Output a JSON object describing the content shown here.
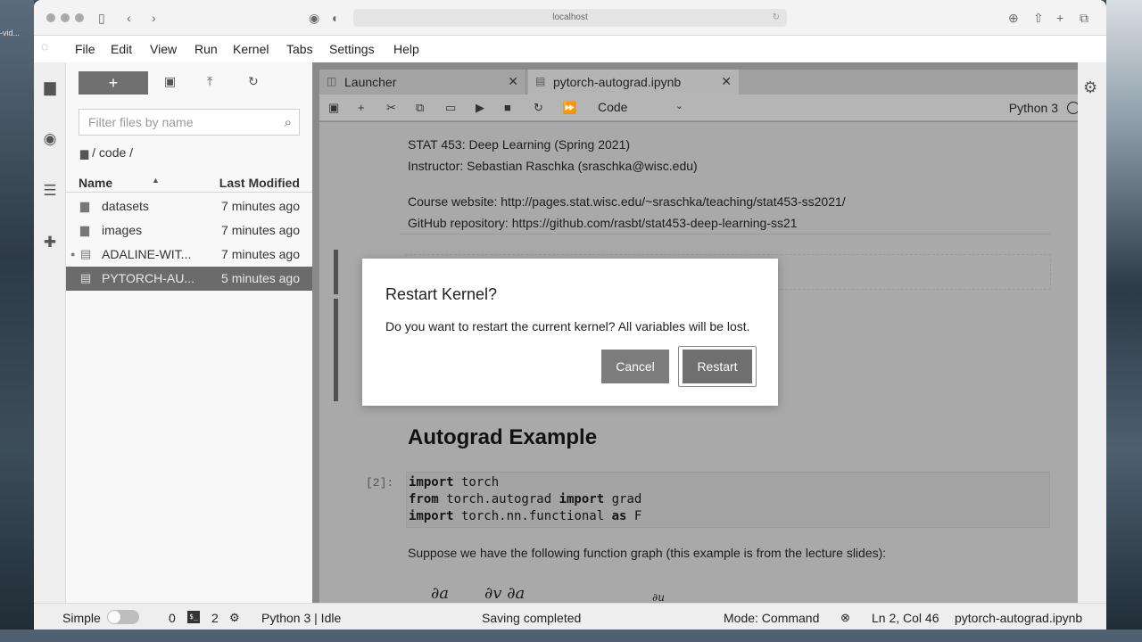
{
  "browser": {
    "url": "localhost",
    "desktop_label": "-vid..."
  },
  "menubar": {
    "items": [
      "File",
      "Edit",
      "View",
      "Run",
      "Kernel",
      "Tabs",
      "Settings",
      "Help"
    ]
  },
  "filebrowser": {
    "new_label": "+",
    "filter_placeholder": "Filter files by name",
    "breadcrumb": "/ code /",
    "col_name": "Name",
    "col_modified": "Last Modified",
    "files": [
      {
        "name": "datasets",
        "modified": "7 minutes ago",
        "icon": "folder-icon"
      },
      {
        "name": "images",
        "modified": "7 minutes ago",
        "icon": "folder-icon"
      },
      {
        "name": "ADALINE-WIT...",
        "modified": "7 minutes ago",
        "icon": "notebook-icon",
        "running": true
      },
      {
        "name": "PYTORCH-AU...",
        "modified": "5 minutes ago",
        "icon": "notebook-icon",
        "selected": true
      }
    ]
  },
  "tabs": [
    {
      "label": "Launcher",
      "icon": "launcher-icon"
    },
    {
      "label": "pytorch-autograd.ipynb",
      "icon": "notebook-icon",
      "active": true
    }
  ],
  "notebook_toolbar": {
    "cell_type": "Code",
    "kernel": "Python 3"
  },
  "notebook": {
    "course_line": "STAT 453: Deep Learning (Spring 2021)",
    "instructor_line": "Instructor: Sebastian Raschka (sraschka@wisc.edu)",
    "website_line": "Course website: http://pages.stat.wisc.edu/~sraschka/teaching/stat453-ss2021/",
    "github_line": "GitHub repository: https://github.com/rasbt/stat453-deep-learning-ss21",
    "heading": "Autograd Example",
    "prompt": "[2]:",
    "code": [
      {
        "kw": "import",
        "rest": " torch"
      },
      {
        "kw": "from",
        "rest": " torch.autograd ",
        "kw2": "import",
        "rest2": " grad"
      },
      {
        "kw": "import",
        "rest": " torch.nn.functional ",
        "kw2": "as",
        "rest2": " F"
      }
    ],
    "suppose_line": "Suppose we have the following function graph (this example is from the lecture slides):",
    "math_1": "∂a",
    "math_2": "∂v ∂a",
    "math_3": "∂u"
  },
  "dialog": {
    "title": "Restart Kernel?",
    "body": "Do you want to restart the current kernel? All variables will be lost.",
    "cancel": "Cancel",
    "confirm": "Restart"
  },
  "statusbar": {
    "mode_label": "Simple",
    "count_1": "0",
    "terminal_label": "$_",
    "count_2": "2",
    "kernel_status": "Python 3 | Idle",
    "save_status": "Saving completed",
    "mode": "Mode: Command",
    "position": "Ln 2, Col 46",
    "filename": "pytorch-autograd.ipynb"
  }
}
